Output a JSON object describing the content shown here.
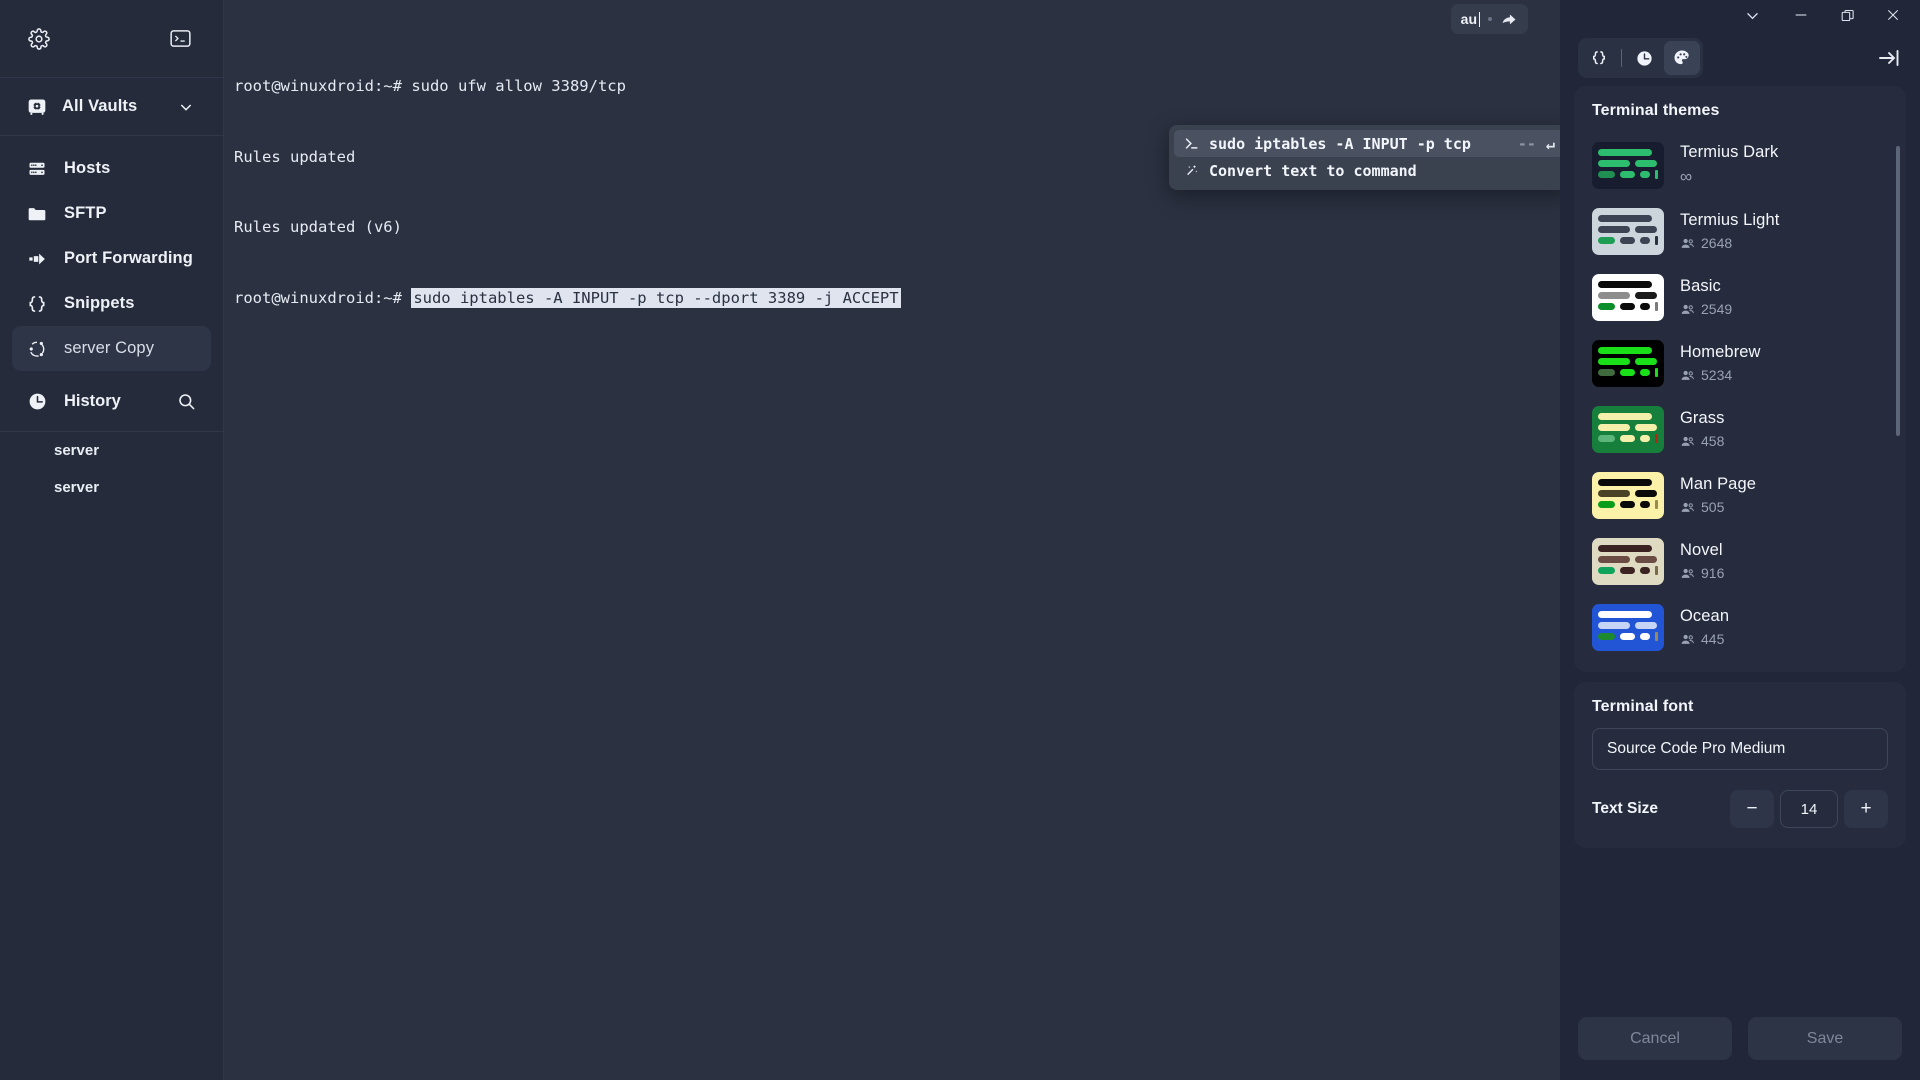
{
  "sidebar": {
    "settings_icon": "gear-icon",
    "terminal_icon": "terminal-icon",
    "vault": {
      "label": "All Vaults",
      "icon": "vault-icon",
      "chevron": "chevron-down-icon"
    },
    "items": [
      {
        "label": "Hosts",
        "icon": "server-icon"
      },
      {
        "label": "SFTP",
        "icon": "folder-icon"
      },
      {
        "label": "Port Forwarding",
        "icon": "port-forward-icon"
      },
      {
        "label": "Snippets",
        "icon": "braces-icon"
      },
      {
        "label": "server Copy",
        "icon": "ubuntu-icon",
        "selected": true
      }
    ],
    "history": {
      "label": "History",
      "icon": "clock-icon",
      "search_icon": "search-icon"
    },
    "history_items": [
      {
        "label": "server"
      },
      {
        "label": "server"
      }
    ]
  },
  "terminal": {
    "lines": [
      {
        "prompt": "root@winuxdroid:~# ",
        "text": "sudo ufw allow 3389/tcp",
        "selected": false
      },
      {
        "prompt": "",
        "text": "Rules updated",
        "selected": false
      },
      {
        "prompt": "",
        "text": "Rules updated (v6)",
        "selected": false
      },
      {
        "prompt": "root@winuxdroid:~# ",
        "text": "sudo iptables -A INPUT -p tcp --dport 3389 -j ACCEPT",
        "selected": true
      }
    ],
    "search_chip": {
      "value": "au",
      "share_icon": "share-icon"
    },
    "autocomplete": {
      "rows": [
        {
          "icon": "prompt-icon",
          "text": "sudo iptables -A INPUT -p tcp ",
          "dim": "--",
          "enter": "↵",
          "active": true
        },
        {
          "icon": "magic-wand-icon",
          "text": "Convert text to command",
          "dim": "",
          "enter": "",
          "active": false
        }
      ]
    }
  },
  "rightpanel": {
    "window_controls": {
      "chevron": "chevron-down-icon",
      "minimize": "minimize-icon",
      "maximize": "restore-icon",
      "close": "close-icon"
    },
    "toolbar": {
      "snippets_icon": "braces-icon",
      "history_icon": "clock-icon",
      "theme_icon": "palette-icon",
      "collapse_icon": "collapse-right-icon"
    },
    "themes_card": {
      "title": "Terminal themes"
    },
    "themes": [
      {
        "name": "Termius Dark",
        "count": "∞",
        "has_people_icon": false,
        "bg": "#171c2e",
        "c1": "#2dbd6e",
        "c2": "#2dbd6e",
        "c3": "#2dbd6e",
        "c4": "#1f8f52",
        "c5": "#2dbd6e",
        "c6": "#2dbd6e",
        "cursor": "#2dbd6e"
      },
      {
        "name": "Termius Light",
        "count": "2648",
        "has_people_icon": true,
        "bg": "#ccd5dc",
        "c1": "#3c4352",
        "c2": "#3c4352",
        "c3": "#3c4352",
        "c4": "#1e9e54",
        "c5": "#3c4352",
        "c6": "#3c4352",
        "cursor": "#2b3040"
      },
      {
        "name": "Basic",
        "count": "2549",
        "has_people_icon": true,
        "bg": "#ffffff",
        "c1": "#0a0a0a",
        "c2": "#8d8d8d",
        "c3": "#1a1a1a",
        "c4": "#0a8f2b",
        "c5": "#0a0a0a",
        "c6": "#0a0a0a",
        "cursor": "#7a7a7a"
      },
      {
        "name": "Homebrew",
        "count": "5234",
        "has_people_icon": true,
        "bg": "#000000",
        "c1": "#1ae01a",
        "c2": "#1ae01a",
        "c3": "#1ae01a",
        "c4": "#3f6b3f",
        "c5": "#1ae01a",
        "c6": "#1ae01a",
        "cursor": "#1ae01a"
      },
      {
        "name": "Grass",
        "count": "458",
        "has_people_icon": true,
        "bg": "#177f3c",
        "c1": "#f5efac",
        "c2": "#f5efac",
        "c3": "#f5efac",
        "c4": "#5cb57a",
        "c5": "#f5efac",
        "c6": "#f5efac",
        "cursor": "#b02b13"
      },
      {
        "name": "Man Page",
        "count": "505",
        "has_people_icon": true,
        "bg": "#fbf1a9",
        "c1": "#0a0a0a",
        "c2": "#4a4226",
        "c3": "#0a0a0a",
        "c4": "#0a9e1c",
        "c5": "#0a0a0a",
        "c6": "#0a0a0a",
        "cursor": "#9a8c4a"
      },
      {
        "name": "Novel",
        "count": "916",
        "has_people_icon": true,
        "bg": "#dfdbc3",
        "c1": "#3b2322",
        "c2": "#6b4c44",
        "c3": "#6b4c44",
        "c4": "#0fa35b",
        "c5": "#3b2322",
        "c6": "#3b2322",
        "cursor": "#7a6a4a"
      },
      {
        "name": "Ocean",
        "count": "445",
        "has_people_icon": true,
        "bg": "#2255d6",
        "c1": "#ffffff",
        "c2": "#c6d5f5",
        "c3": "#c6d5f5",
        "c4": "#1e8a2e",
        "c5": "#ffffff",
        "c6": "#ffffff",
        "cursor": "#9a8a5a"
      }
    ],
    "font_card": {
      "title": "Terminal font",
      "font_value": "Source Code Pro Medium",
      "size_label": "Text Size",
      "size_value": "14",
      "minus_label": "−",
      "plus_label": "+"
    },
    "footer": {
      "cancel": "Cancel",
      "save": "Save"
    }
  }
}
